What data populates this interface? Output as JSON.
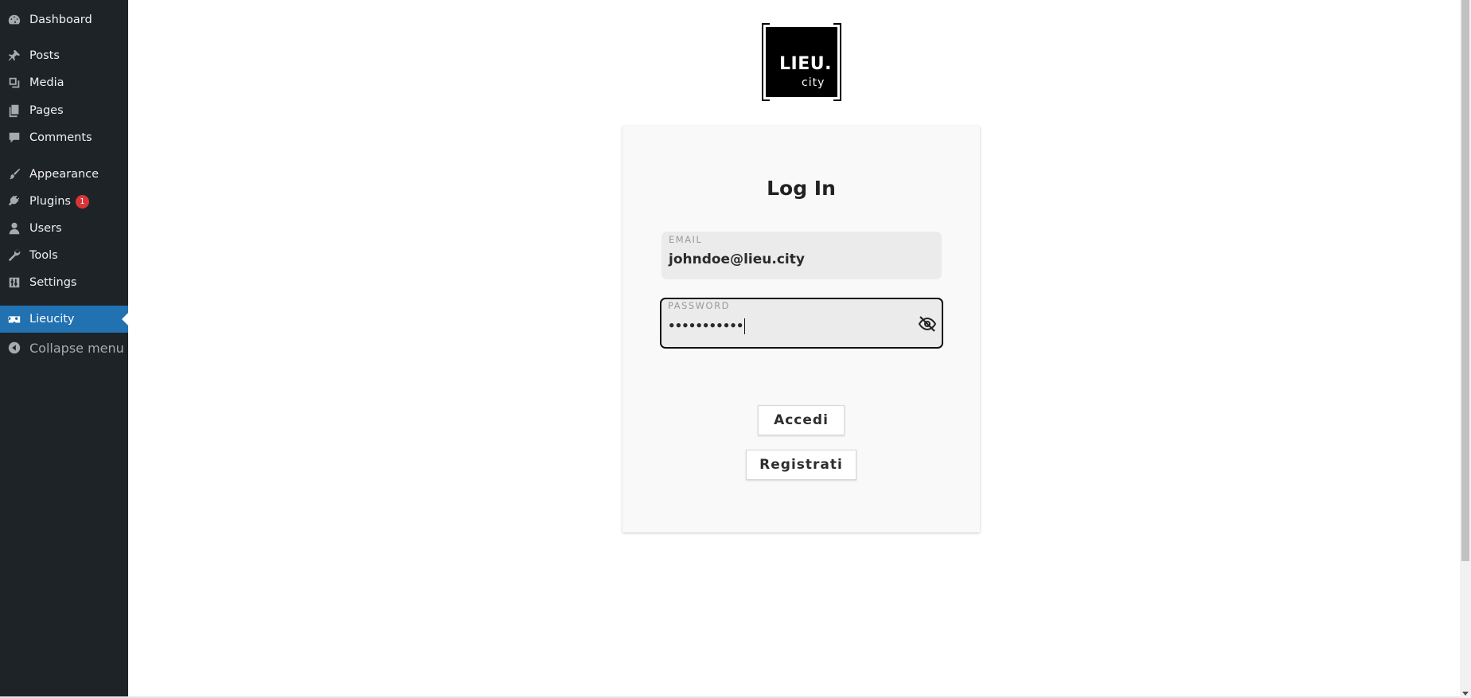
{
  "sidebar": {
    "items": [
      {
        "label": "Dashboard",
        "icon": "dashboard-icon"
      },
      {
        "label": "Posts",
        "icon": "pin-icon"
      },
      {
        "label": "Media",
        "icon": "media-icon"
      },
      {
        "label": "Pages",
        "icon": "pages-icon"
      },
      {
        "label": "Comments",
        "icon": "comment-icon"
      },
      {
        "label": "Appearance",
        "icon": "paintbrush-icon"
      },
      {
        "label": "Plugins",
        "icon": "plug-icon",
        "badge": "1"
      },
      {
        "label": "Users",
        "icon": "user-icon"
      },
      {
        "label": "Tools",
        "icon": "wrench-icon"
      },
      {
        "label": "Settings",
        "icon": "settings-icon"
      },
      {
        "label": "Lieucity",
        "icon": "vr-goggles-icon",
        "active": true
      },
      {
        "label": "Collapse menu",
        "icon": "collapse-icon"
      }
    ]
  },
  "logo": {
    "line1": "LIEU.",
    "line2": "city"
  },
  "login": {
    "title": "Log In",
    "email_label": "EMAIL",
    "email_value": "johndoe@lieu.city",
    "password_label": "PASSWORD",
    "password_value": "•••••••••••",
    "submit_label": "Accedi",
    "register_label": "Registrati"
  },
  "colors": {
    "sidebar_bg": "#1e2327",
    "active_bg": "#2271b1",
    "badge": "#d63638",
    "card_bg": "#f9f9f9"
  }
}
